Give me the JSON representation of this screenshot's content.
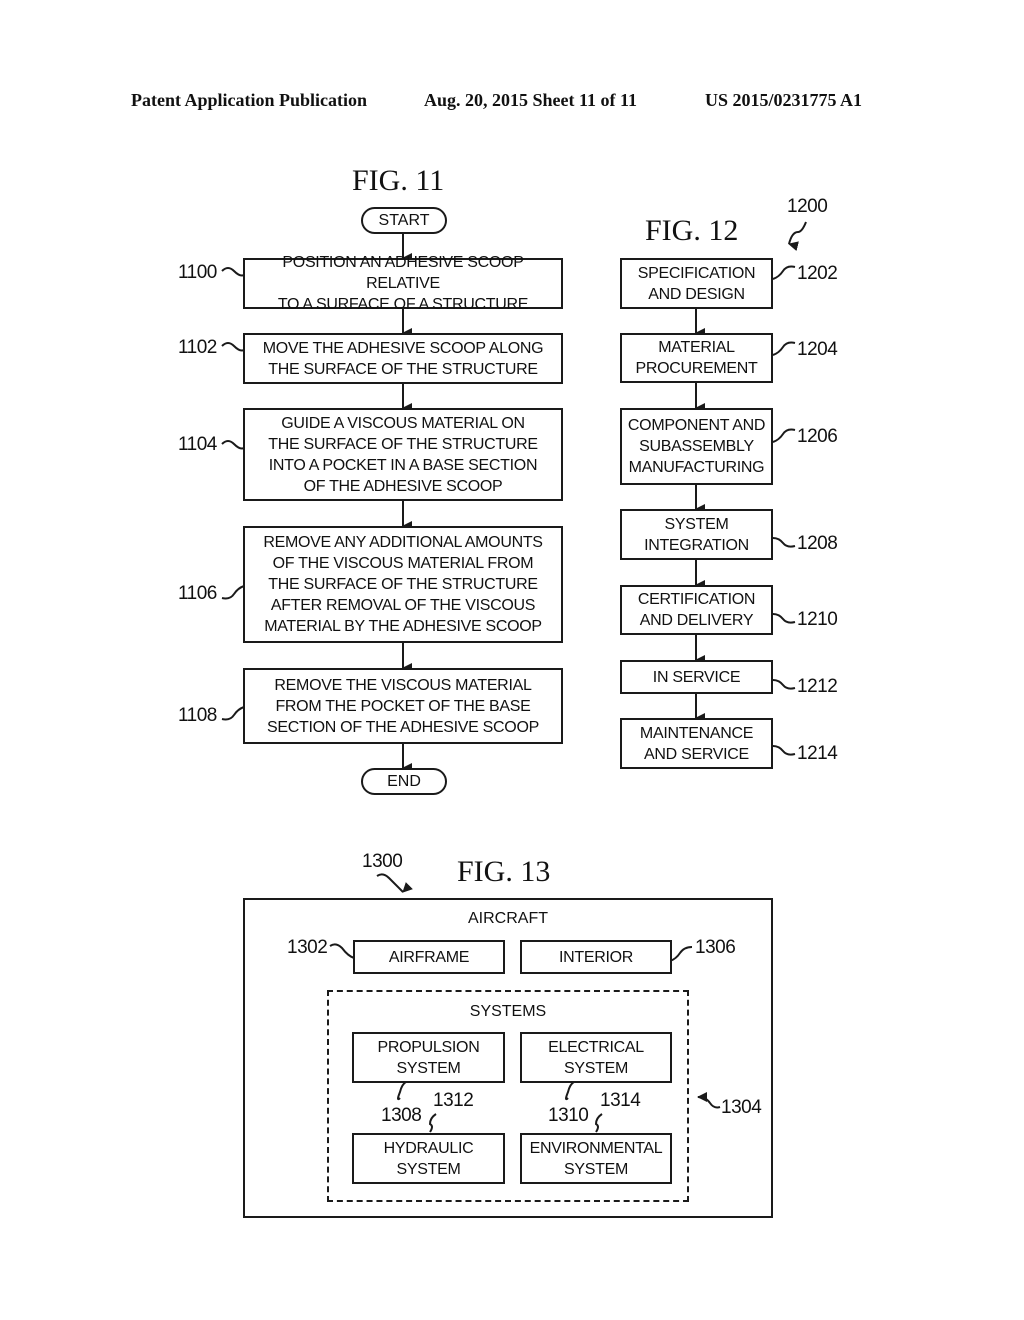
{
  "header": {
    "publication": "Patent Application Publication",
    "date_sheet": "Aug. 20, 2015  Sheet 11 of 11",
    "patent_number": "US 2015/0231775 A1"
  },
  "fig11": {
    "title": "FIG. 11",
    "start": "START",
    "end": "END",
    "steps": [
      {
        "ref": "1100",
        "text": "POSITION AN ADHESIVE SCOOP RELATIVE\nTO A SURFACE OF A STRUCTURE"
      },
      {
        "ref": "1102",
        "text": "MOVE THE ADHESIVE SCOOP ALONG\nTHE SURFACE OF THE STRUCTURE"
      },
      {
        "ref": "1104",
        "text": "GUIDE A VISCOUS MATERIAL ON\nTHE SURFACE OF THE STRUCTURE\nINTO A POCKET IN A BASE SECTION\nOF THE ADHESIVE SCOOP"
      },
      {
        "ref": "1106",
        "text": "REMOVE ANY ADDITIONAL AMOUNTS\nOF THE VISCOUS MATERIAL FROM\nTHE SURFACE OF THE STRUCTURE\nAFTER REMOVAL OF THE VISCOUS\nMATERIAL BY THE ADHESIVE SCOOP"
      },
      {
        "ref": "1108",
        "text": "REMOVE THE VISCOUS MATERIAL\nFROM THE POCKET OF THE BASE\nSECTION OF THE ADHESIVE SCOOP"
      }
    ]
  },
  "fig12": {
    "title": "FIG. 12",
    "ref": "1200",
    "steps": [
      {
        "ref": "1202",
        "text": "SPECIFICATION\nAND DESIGN"
      },
      {
        "ref": "1204",
        "text": "MATERIAL\nPROCUREMENT"
      },
      {
        "ref": "1206",
        "text": "COMPONENT AND\nSUBASSEMBLY\nMANUFACTURING"
      },
      {
        "ref": "1208",
        "text": "SYSTEM\nINTEGRATION"
      },
      {
        "ref": "1210",
        "text": "CERTIFICATION\nAND DELIVERY"
      },
      {
        "ref": "1212",
        "text": "IN SERVICE"
      },
      {
        "ref": "1214",
        "text": "MAINTENANCE\nAND SERVICE"
      }
    ]
  },
  "fig13": {
    "title": "FIG. 13",
    "ref": "1300",
    "aircraft_label": "AIRCRAFT",
    "airframe": {
      "ref": "1302",
      "text": "AIRFRAME"
    },
    "interior": {
      "ref": "1306",
      "text": "INTERIOR"
    },
    "systems": {
      "ref": "1304",
      "label": "SYSTEMS",
      "propulsion": {
        "ref": "1308",
        "text": "PROPULSION\nSYSTEM"
      },
      "electrical": {
        "ref": "1310",
        "text": "ELECTRICAL\nSYSTEM"
      },
      "hydraulic": {
        "ref": "1312",
        "text": "HYDRAULIC\nSYSTEM"
      },
      "environmental": {
        "ref": "1314",
        "text": "ENVIRONMENTAL\nSYSTEM"
      }
    }
  }
}
